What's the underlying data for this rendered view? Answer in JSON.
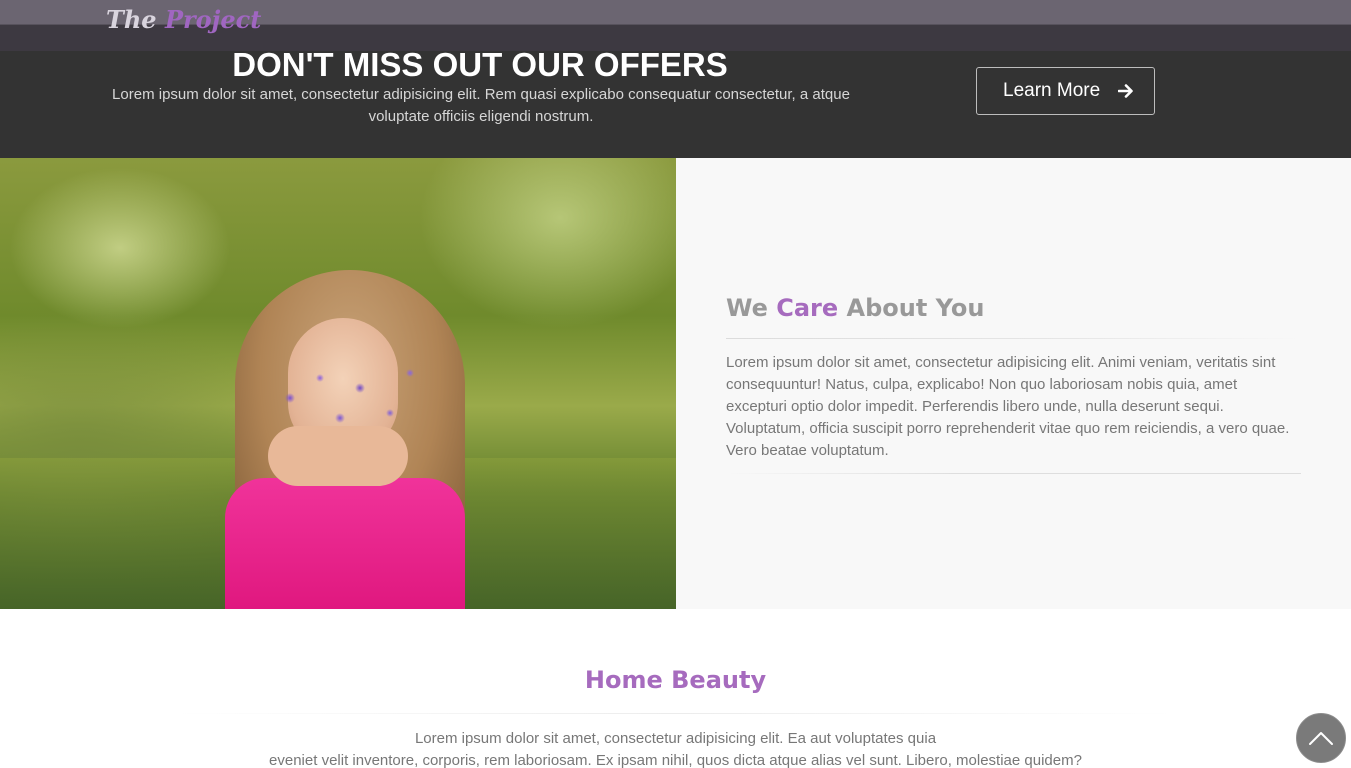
{
  "header": {
    "logo_the": "The",
    "logo_project": "Project"
  },
  "offer": {
    "title": "DON'T MISS OUT OUR OFFERS",
    "text": "Lorem ipsum dolor sit amet, consectetur adipisicing elit. Rem quasi explicabo consequatur consectetur, a atque voluptate officiis eligendi nostrum.",
    "button_label": "Learn More",
    "button_icon": "arrow-right-icon"
  },
  "care": {
    "title_pre": "We ",
    "title_accent": "Care",
    "title_post": " About You",
    "text": "Lorem ipsum dolor sit amet, consectetur adipisicing elit. Animi veniam, veritatis sint consequuntur! Natus, culpa, explicabo! Non quo laboriosam nobis quia, amet excepturi optio dolor impedit. Perferendis libero unde, nulla deserunt sequi. Voluptatum, officia suscipit porro reprehenderit vitae quo rem reiciendis, a vero quae. Vero beatae voluptatum."
  },
  "beauty": {
    "title": "Home Beauty",
    "line1": "Lorem ipsum dolor sit amet, consectetur adipisicing elit. Ea aut voluptates quia",
    "line2": "eveniet velit inventore, corporis, rem laboriosam. Ex ipsam nihil, quos dicta atque alias vel sunt. Libero, molestiae quidem?"
  },
  "scroll_top": {
    "icon": "chevron-up-icon"
  },
  "colors": {
    "accent": "#a66bbe",
    "banner_bg": "#333333",
    "navbar_bg": "#3e3a42",
    "panel_bg": "#f8f8f8"
  }
}
